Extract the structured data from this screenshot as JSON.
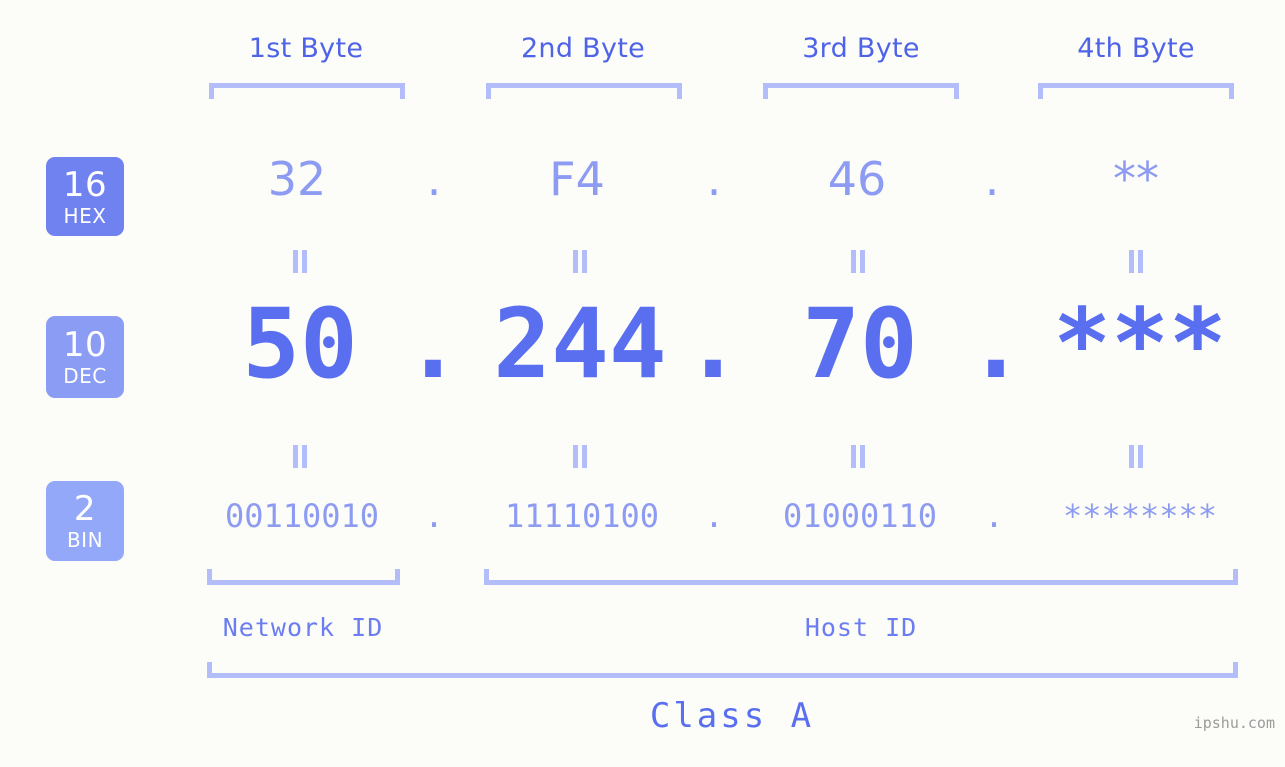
{
  "page": {
    "title": "IP Address Byte Breakdown",
    "background_color": "#fcfdf8",
    "accent_color": "#5a6ff0",
    "accent_light_color": "#8d9cf2",
    "bracket_color": "#b3bdfa",
    "watermark": "ipshu.com"
  },
  "byte_headers": [
    {
      "label": "1st Byte"
    },
    {
      "label": "2nd Byte"
    },
    {
      "label": "3rd Byte"
    },
    {
      "label": "4th Byte"
    }
  ],
  "bases": [
    {
      "number": "16",
      "name": "HEX",
      "color": "#6f82ef"
    },
    {
      "number": "10",
      "name": "DEC",
      "color": "#8b9cf4"
    },
    {
      "number": "2",
      "name": "BIN",
      "color": "#93a8f8"
    }
  ],
  "rows": {
    "hex": {
      "base_number": "16",
      "base_name": "HEX",
      "values": [
        "32",
        "F4",
        "46",
        "**"
      ],
      "separator": "."
    },
    "dec": {
      "base_number": "10",
      "base_name": "DEC",
      "values": [
        "50",
        "244",
        "70",
        "***"
      ],
      "separator": "."
    },
    "bin": {
      "base_number": "2",
      "base_name": "BIN",
      "values": [
        "00110010",
        "11110100",
        "01000110",
        "********"
      ],
      "separator": "."
    }
  },
  "equality_marks": {
    "symbol": "=",
    "count_per_row_gap": 4
  },
  "sections": [
    {
      "label": "Network ID"
    },
    {
      "label": "Host ID"
    }
  ],
  "class": {
    "label": "Class A"
  }
}
